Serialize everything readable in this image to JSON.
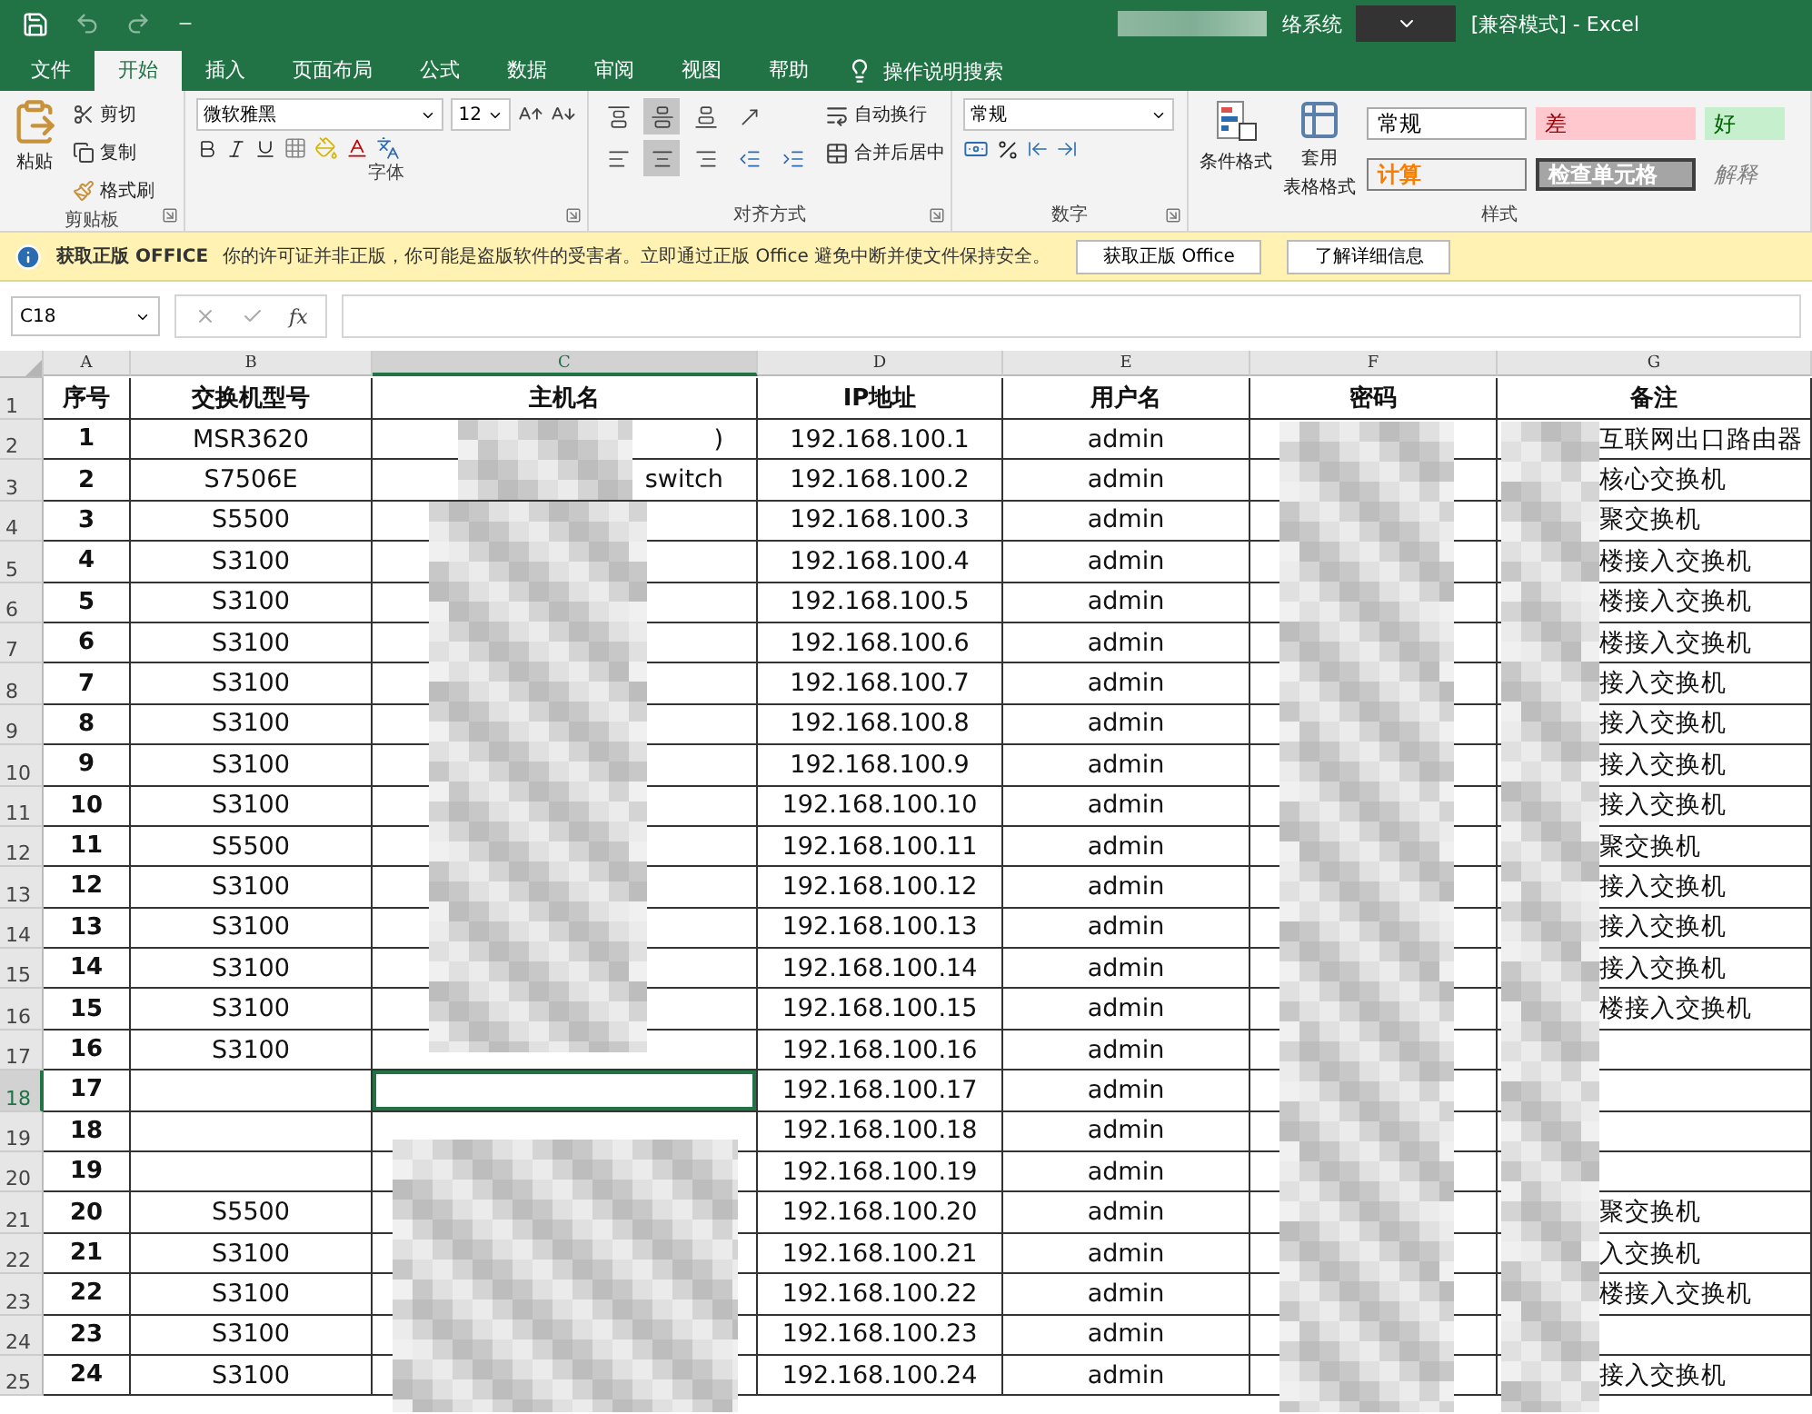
{
  "title_bar": {
    "title_fragment": "络系统",
    "title": "[兼容模式] - Excel"
  },
  "menu_tabs": [
    {
      "label": "文件",
      "selected": false
    },
    {
      "label": "开始",
      "selected": true
    },
    {
      "label": "插入",
      "selected": false
    },
    {
      "label": "页面布局",
      "selected": false
    },
    {
      "label": "公式",
      "selected": false
    },
    {
      "label": "数据",
      "selected": false
    },
    {
      "label": "审阅",
      "selected": false
    },
    {
      "label": "视图",
      "selected": false
    },
    {
      "label": "帮助",
      "selected": false
    }
  ],
  "tell_me": "操作说明搜索",
  "ribbon": {
    "clipboard": {
      "paste": "粘贴",
      "cut": "剪切",
      "copy": "复制",
      "format_painter": "格式刷",
      "label": "剪贴板"
    },
    "font": {
      "font_name": "微软雅黑",
      "font_size": "12",
      "label": "字体"
    },
    "alignment": {
      "wrap": "自动换行",
      "merge": "合并后居中",
      "label": "对齐方式"
    },
    "number": {
      "format": "常规",
      "label": "数字"
    },
    "styles": {
      "conditional": "条件格式",
      "table_format": [
        "套用",
        "表格格式"
      ],
      "label": "样式",
      "cells": [
        {
          "label": "常规",
          "kind": "normal"
        },
        {
          "label": "差",
          "kind": "bad"
        },
        {
          "label": "好",
          "kind": "good"
        },
        {
          "label": "计算",
          "kind": "calc"
        },
        {
          "label": "检查单元格",
          "kind": "check"
        },
        {
          "label": "解释",
          "kind": "explain"
        }
      ]
    }
  },
  "info_bar": {
    "title": "获取正版 OFFICE",
    "message": "你的许可证并非正版，你可能是盗版软件的受害者。立即通过正版 Office 避免中断并使文件保持安全。",
    "buttons": [
      "获取正版 Office",
      "了解详细信息"
    ]
  },
  "formula_bar": {
    "name_box": "C18",
    "fx": "fx"
  },
  "sheet": {
    "columns": [
      {
        "letter": "A",
        "selected": false
      },
      {
        "letter": "B",
        "selected": false
      },
      {
        "letter": "C",
        "selected": true
      },
      {
        "letter": "D",
        "selected": false
      },
      {
        "letter": "E",
        "selected": false
      },
      {
        "letter": "F",
        "selected": false
      },
      {
        "letter": "G",
        "selected": false
      }
    ],
    "rows": [
      {
        "number": "1",
        "kind": "header",
        "selected": false,
        "cells": {
          "a": "序号",
          "b": "交换机型号",
          "c": "主机名",
          "d": "IP地址",
          "e": "用户名",
          "f": "密码",
          "g": "备注"
        }
      },
      {
        "number": "2",
        "selected": false,
        "cells": {
          "a": "1",
          "b": "MSR3620",
          "c": ")",
          "d": "192.168.100.1",
          "e": "admin",
          "g": "互联网出口路由器"
        }
      },
      {
        "number": "3",
        "selected": false,
        "cells": {
          "a": "2",
          "b": "S7506E",
          "c": "switch",
          "d": "192.168.100.2",
          "e": "admin",
          "g": "核心交换机"
        }
      },
      {
        "number": "4",
        "selected": false,
        "cells": {
          "a": "3",
          "b": "S5500",
          "d": "192.168.100.3",
          "e": "admin",
          "g": "聚交换机"
        }
      },
      {
        "number": "5",
        "selected": false,
        "cells": {
          "a": "4",
          "b": "S3100",
          "d": "192.168.100.4",
          "e": "admin",
          "g": "楼接入交换机"
        }
      },
      {
        "number": "6",
        "selected": false,
        "cells": {
          "a": "5",
          "b": "S3100",
          "d": "192.168.100.5",
          "e": "admin",
          "g": "楼接入交换机"
        }
      },
      {
        "number": "7",
        "selected": false,
        "cells": {
          "a": "6",
          "b": "S3100",
          "d": "192.168.100.6",
          "e": "admin",
          "g": "楼接入交换机"
        }
      },
      {
        "number": "8",
        "selected": false,
        "cells": {
          "a": "7",
          "b": "S3100",
          "d": "192.168.100.7",
          "e": "admin",
          "g": "接入交换机"
        }
      },
      {
        "number": "9",
        "selected": false,
        "cells": {
          "a": "8",
          "b": "S3100",
          "d": "192.168.100.8",
          "e": "admin",
          "g": "接入交换机"
        }
      },
      {
        "number": "10",
        "selected": false,
        "cells": {
          "a": "9",
          "b": "S3100",
          "d": "192.168.100.9",
          "e": "admin",
          "g": "接入交换机"
        }
      },
      {
        "number": "11",
        "selected": false,
        "cells": {
          "a": "10",
          "b": "S3100",
          "d": "192.168.100.10",
          "e": "admin",
          "g": "接入交换机"
        }
      },
      {
        "number": "12",
        "selected": false,
        "cells": {
          "a": "11",
          "b": "S5500",
          "d": "192.168.100.11",
          "e": "admin",
          "g": "聚交换机"
        }
      },
      {
        "number": "13",
        "selected": false,
        "cells": {
          "a": "12",
          "b": "S3100",
          "d": "192.168.100.12",
          "e": "admin",
          "g": "接入交换机"
        }
      },
      {
        "number": "14",
        "selected": false,
        "cells": {
          "a": "13",
          "b": "S3100",
          "d": "192.168.100.13",
          "e": "admin",
          "g": "接入交换机"
        }
      },
      {
        "number": "15",
        "selected": false,
        "cells": {
          "a": "14",
          "b": "S3100",
          "d": "192.168.100.14",
          "e": "admin",
          "g": "接入交换机"
        }
      },
      {
        "number": "16",
        "selected": false,
        "cells": {
          "a": "15",
          "b": "S3100",
          "d": "192.168.100.15",
          "e": "admin",
          "g": "楼接入交换机"
        }
      },
      {
        "number": "17",
        "selected": false,
        "cells": {
          "a": "16",
          "b": "S3100",
          "d": "192.168.100.16",
          "e": "admin"
        }
      },
      {
        "number": "18",
        "selected": true,
        "cells": {
          "a": "17",
          "d": "192.168.100.17",
          "e": "admin"
        }
      },
      {
        "number": "19",
        "selected": false,
        "cells": {
          "a": "18",
          "d": "192.168.100.18",
          "e": "admin"
        }
      },
      {
        "number": "20",
        "selected": false,
        "cells": {
          "a": "19",
          "d": "192.168.100.19",
          "e": "admin"
        }
      },
      {
        "number": "21",
        "selected": false,
        "cells": {
          "a": "20",
          "b": "S5500",
          "d": "192.168.100.20",
          "e": "admin",
          "g": "聚交换机"
        }
      },
      {
        "number": "22",
        "selected": false,
        "cells": {
          "a": "21",
          "b": "S3100",
          "d": "192.168.100.21",
          "e": "admin",
          "g": "入交换机"
        }
      },
      {
        "number": "23",
        "selected": false,
        "cells": {
          "a": "22",
          "b": "S3100",
          "d": "192.168.100.22",
          "e": "admin",
          "g": "楼接入交换机"
        }
      },
      {
        "number": "24",
        "selected": false,
        "cells": {
          "a": "23",
          "b": "S3100",
          "d": "192.168.100.23",
          "e": "admin"
        }
      },
      {
        "number": "25",
        "selected": false,
        "cells": {
          "a": "24",
          "b": "S3100",
          "d": "192.168.100.24",
          "e": "admin",
          "g": "接入交换机"
        }
      }
    ]
  }
}
